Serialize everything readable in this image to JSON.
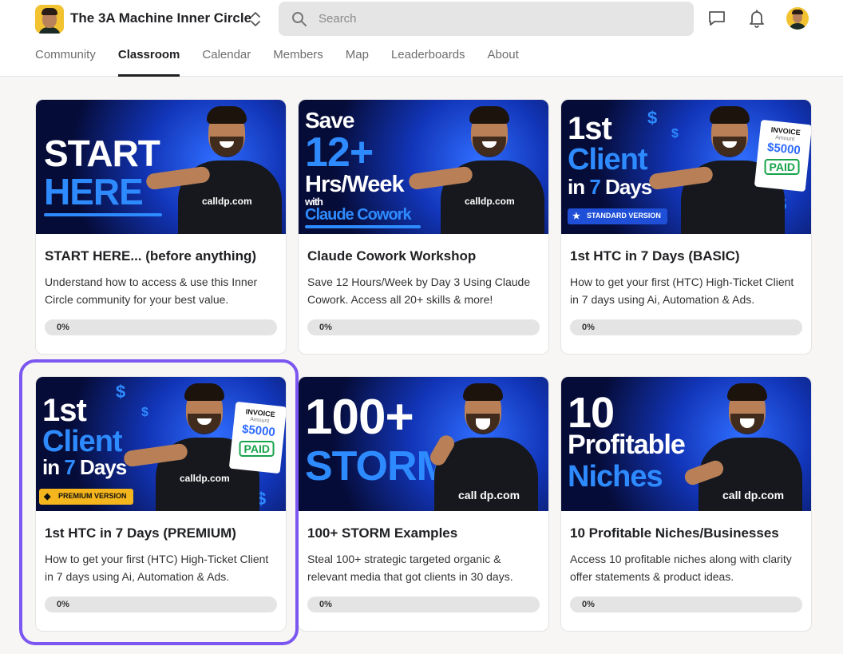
{
  "header": {
    "group_name": "The 3A Machine Inner Circle",
    "search_placeholder": "Search"
  },
  "tabs": [
    {
      "label": "Community",
      "active": false
    },
    {
      "label": "Classroom",
      "active": true
    },
    {
      "label": "Calendar",
      "active": false
    },
    {
      "label": "Members",
      "active": false
    },
    {
      "label": "Map",
      "active": false
    },
    {
      "label": "Leaderboards",
      "active": false
    },
    {
      "label": "About",
      "active": false
    }
  ],
  "courses": [
    {
      "title": "START HERE... (before anything)",
      "description": "Understand how to access & use this Inner Circle community for your best value.",
      "progress_label": "0%",
      "progress": 0,
      "thumbnail": {
        "line1": "START",
        "line2": "HERE",
        "brand": "calldp.com"
      }
    },
    {
      "title": "Claude Cowork Workshop",
      "description": "Save 12 Hours/Week by Day 3 Using Claude Cowork. Access all 20+ skills & more!",
      "progress_label": "0%",
      "progress": 0,
      "thumbnail": {
        "line1": "Save",
        "line2": "12+",
        "line3": "Hrs/Week",
        "line4": "with",
        "line5": "Claude Cowork",
        "brand": "calldp.com"
      }
    },
    {
      "title": "1st HTC in 7 Days (BASIC)",
      "description": "How to get your first (HTC) High-Ticket Client in 7 days using Ai, Automation & Ads.",
      "progress_label": "0%",
      "progress": 0,
      "thumbnail": {
        "line1": "1st",
        "line2": "Client",
        "line3a": "in ",
        "line3b": "7",
        "line3c": " Days",
        "badge": "STANDARD VERSION",
        "invoice_title": "INVOICE",
        "invoice_sub": "Amount",
        "invoice_amount": "$5000",
        "invoice_status": "PAID"
      }
    },
    {
      "title": "1st HTC in 7 Days (PREMIUM)",
      "description": "How to get your first (HTC) High-Ticket Client in 7 days using Ai, Automation & Ads.",
      "progress_label": "0%",
      "progress": 0,
      "thumbnail": {
        "line1": "1st",
        "line2": "Client",
        "line3a": "in ",
        "line3b": "7",
        "line3c": " Days",
        "badge": "PREMIUM VERSION",
        "invoice_title": "INVOICE",
        "invoice_sub": "Amount",
        "invoice_amount": "$5000",
        "invoice_status": "PAID",
        "brand": "calldp.com"
      }
    },
    {
      "title": "100+ STORM Examples",
      "description": "Steal 100+ strategic targeted organic & relevant media that got clients in 30 days.",
      "progress_label": "0%",
      "progress": 0,
      "thumbnail": {
        "line1": "100+",
        "line2": "STORM",
        "brand": "call dp.com"
      }
    },
    {
      "title": "10 Profitable Niches/Businesses",
      "description": "Access 10 profitable niches along with clarity offer statements & product ideas.",
      "progress_label": "0%",
      "progress": 0,
      "thumbnail": {
        "line1": "10",
        "line2": "Profitable",
        "line3": "Niches",
        "brand": "call dp.com"
      }
    }
  ],
  "colors": {
    "selection_ring": "#7b56f0",
    "thumbnail_blue": "#2e8bff",
    "paid_green": "#16a34a",
    "premium_gold": "#f4b51d"
  }
}
